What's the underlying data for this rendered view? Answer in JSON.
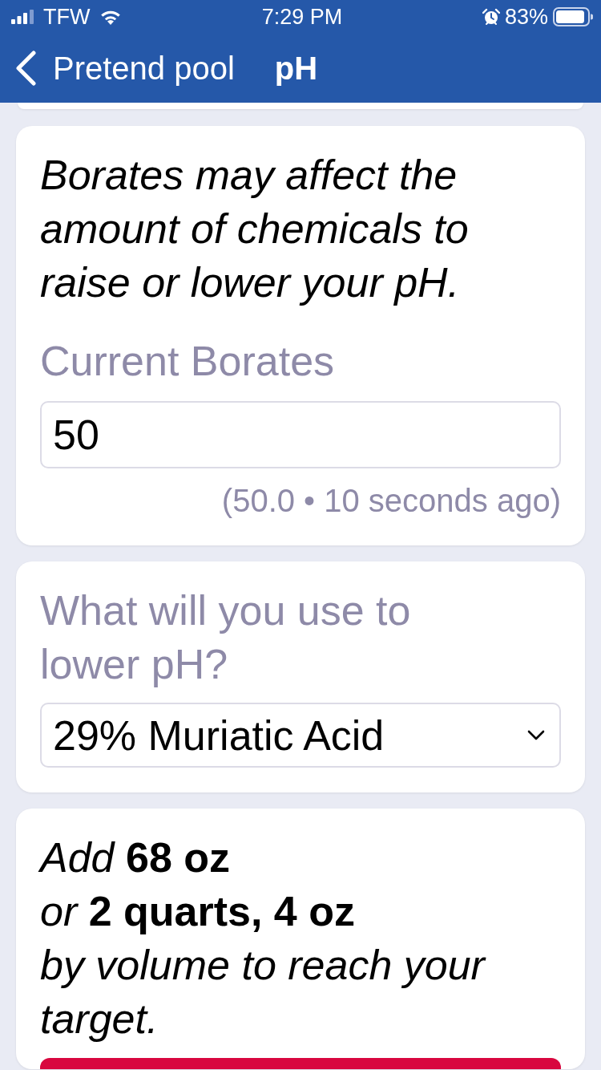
{
  "status_bar": {
    "carrier": "TFW",
    "time": "7:29 PM",
    "battery": "83%"
  },
  "nav": {
    "back_label": "Pretend pool",
    "title": "pH"
  },
  "borates_card": {
    "note": "Borates may affect the amount of chemicals to raise or lower your pH.",
    "label": "Current Borates",
    "value": "50",
    "hint": "(50.0 • 10 seconds ago)"
  },
  "chemical_card": {
    "label": "What will you use to lower pH?",
    "value": "29% Muriatic Acid"
  },
  "result_card": {
    "lines": [
      "Add **68 oz**",
      "or **2 quarts, 4 oz**",
      "by volume to reach your target."
    ]
  }
}
